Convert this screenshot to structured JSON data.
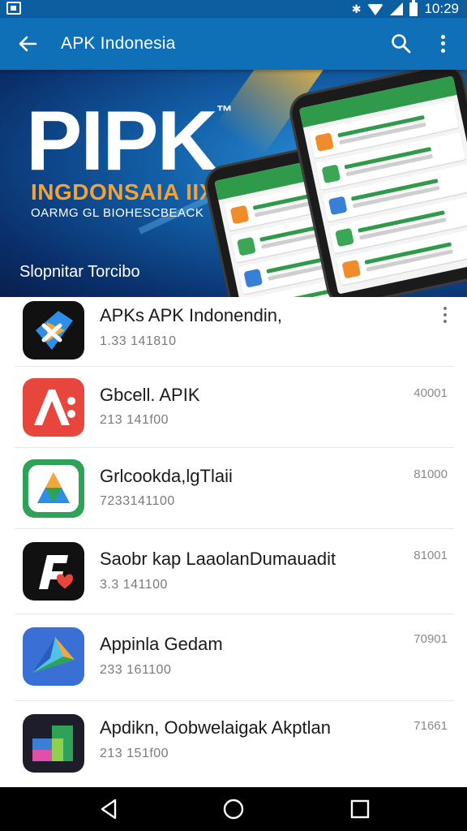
{
  "status_bar": {
    "time": "10:29"
  },
  "app_bar": {
    "title": "APK Indonesia"
  },
  "banner": {
    "headline": "PIPK",
    "trademark": "™",
    "subtitle": "INGDONSAIA IIX",
    "tagline": "OARMG GL BIOHESCBEACK",
    "caption": "Slopnitar Torcibo"
  },
  "apps": [
    {
      "name": "APKs APK Indonendin,",
      "meta": "1.33 141810",
      "count": ""
    },
    {
      "name": "Gbcell. APIK",
      "meta": "213 141f00",
      "count": "40001"
    },
    {
      "name": "Grlcookda,lgTlaii",
      "meta": "7233141100",
      "count": "81000"
    },
    {
      "name": "Saobr kap LaaolanDumauadit",
      "meta": "3.3 141100",
      "count": "81001"
    },
    {
      "name": "Appinla Gedam",
      "meta": "233 161100",
      "count": "70901"
    },
    {
      "name": "Apdikn, Oobwelaigak Akptlan",
      "meta": "213 151f00",
      "count": "71661"
    }
  ]
}
